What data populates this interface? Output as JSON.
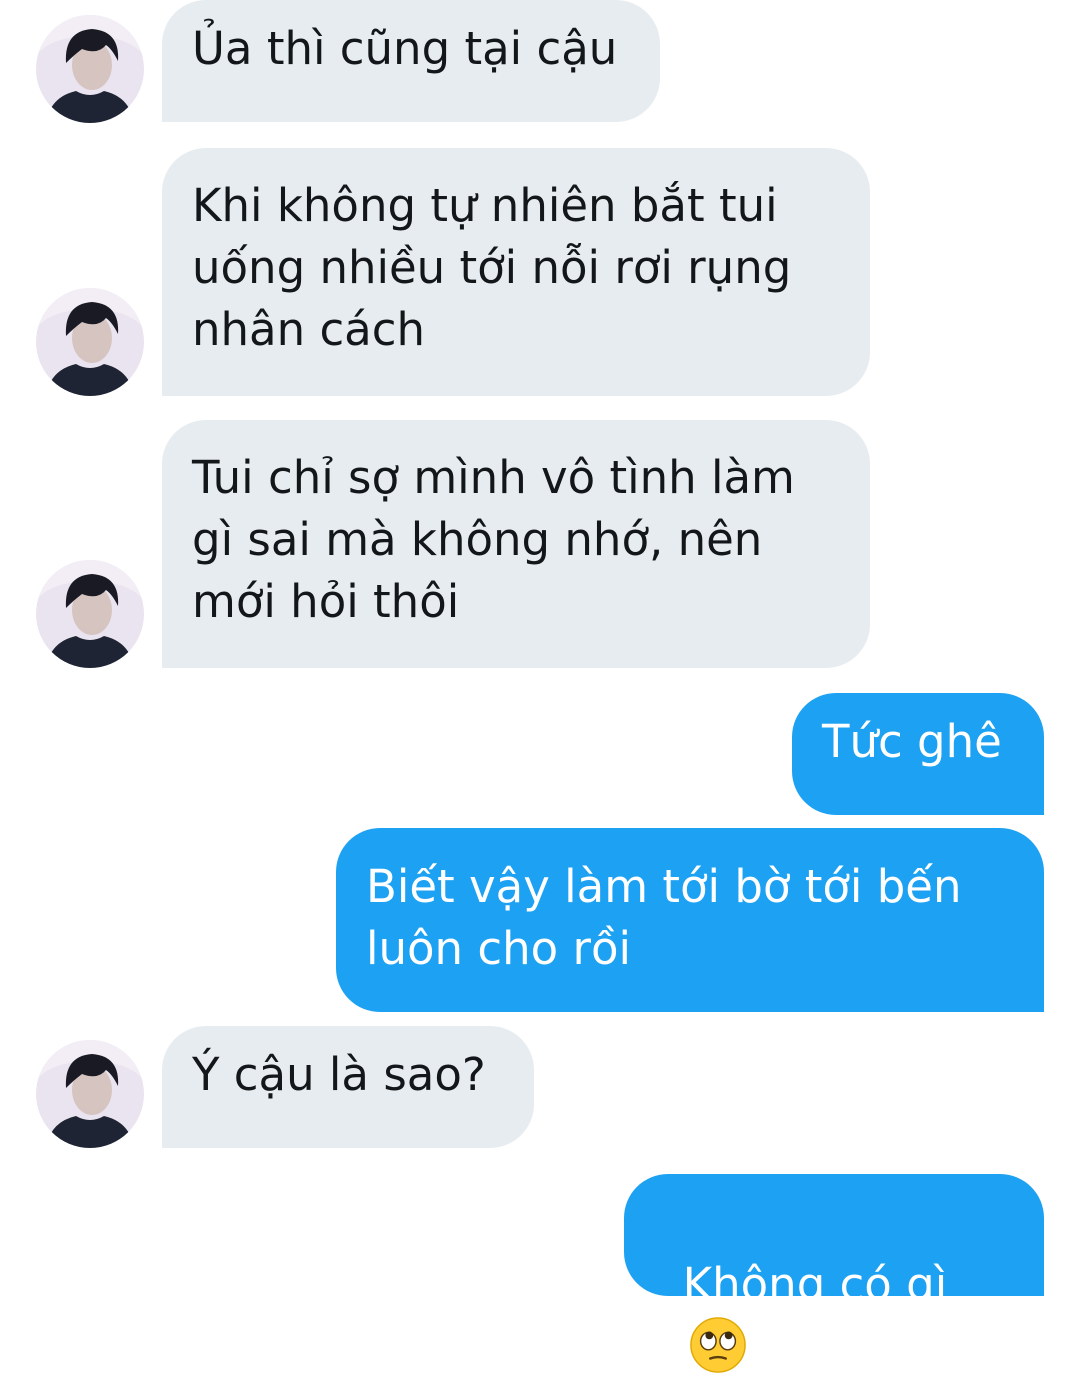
{
  "conversation": {
    "messages": [
      {
        "from": "them",
        "text": "Ủa thì cũng tại cậu"
      },
      {
        "from": "them",
        "text": "Khi không tự nhiên bắt tui\nuống nhiều tới nỗi rơi rụng\nnhân cách"
      },
      {
        "from": "them",
        "text": "Tui chỉ sợ mình vô tình làm\ngì sai mà không nhớ, nên\nmới hỏi thôi"
      },
      {
        "from": "me",
        "text": "Tức ghê"
      },
      {
        "from": "me",
        "text": "Biết vậy làm tới bờ tới bến\nluôn cho rồi"
      },
      {
        "from": "them",
        "text": "Ý cậu là sao?"
      },
      {
        "from": "me",
        "text": "Không có gì",
        "emoji": "face-with-rolling-eyes-icon"
      }
    ]
  },
  "colors": {
    "incoming_bubble": "#e6ecf0",
    "outgoing_bubble": "#1da1f2",
    "incoming_text": "#14171a",
    "outgoing_text": "#ffffff"
  }
}
